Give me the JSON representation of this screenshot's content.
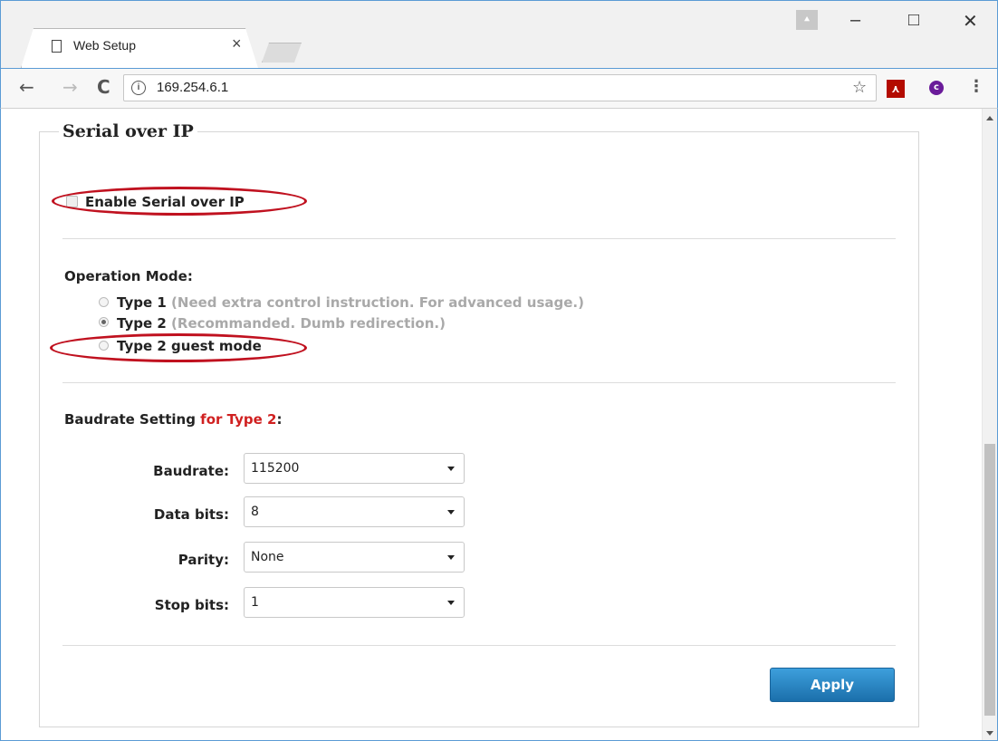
{
  "browser": {
    "tab_title": "Web Setup",
    "tab_close": "×",
    "url": "169.254.6.1",
    "info_glyph": "i",
    "window_controls": {
      "minimize": "–",
      "maximize": "□",
      "close": "✕"
    },
    "nav": {
      "back": "←",
      "forward": "→",
      "reload": "C"
    },
    "icons": {
      "star": "☆",
      "menu": "⋮",
      "pdf": "⋏",
      "ext": "c",
      "user": "⯅"
    }
  },
  "page": {
    "section_title": "Serial over IP",
    "enable_label": "Enable Serial over IP",
    "enable_checked": false,
    "operation_mode": {
      "title": "Operation Mode:",
      "options": [
        {
          "name": "Type 1",
          "hint": "(Need extra control instruction. For advanced usage.)",
          "selected": false
        },
        {
          "name": "Type 2",
          "hint": "(Recommanded. Dumb redirection.)",
          "selected": true
        },
        {
          "name": "Type 2 guest mode",
          "hint": "",
          "selected": false
        }
      ]
    },
    "baudrate_setting": {
      "title_prefix": "Baudrate Setting",
      "title_highlight": "for Type 2",
      "title_suffix": ":",
      "fields": [
        {
          "label": "Baudrate:",
          "value": "115200"
        },
        {
          "label": "Data bits:",
          "value": "8"
        },
        {
          "label": "Parity:",
          "value": "None"
        },
        {
          "label": "Stop bits:",
          "value": "1"
        }
      ]
    },
    "apply_label": "Apply",
    "highlight_color": "#c0111f",
    "accent_color": "#1b6fab"
  }
}
